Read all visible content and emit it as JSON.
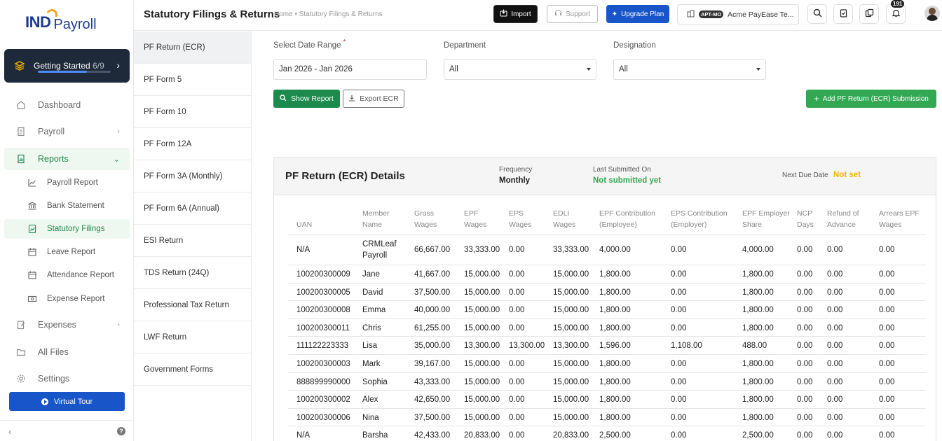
{
  "sidebar": {
    "logo": {
      "ind": "IND",
      "payroll": "Payroll"
    },
    "getting_started": {
      "label": "Getting Started",
      "count": "6/9",
      "progress": 0.67
    },
    "nav": [
      {
        "label": "Dashboard"
      },
      {
        "label": "Payroll"
      },
      {
        "label": "Reports"
      },
      {
        "label": "Expenses"
      },
      {
        "label": "All Files"
      },
      {
        "label": "Settings"
      }
    ],
    "reports_sub": [
      {
        "label": "Payroll Report"
      },
      {
        "label": "Bank Statement"
      },
      {
        "label": "Statutory Filings"
      },
      {
        "label": "Leave Report"
      },
      {
        "label": "Attendance Report"
      },
      {
        "label": "Expense Report"
      }
    ],
    "virtual_tour": "Virtual Tour"
  },
  "header": {
    "title": "Statutory Filings & Returns",
    "breadcrumb": "Home • Statutory Filings & Returns",
    "import": "Import",
    "support": "Support",
    "upgrade": "Upgrade Plan",
    "company_tag": "APT-MO",
    "company_name": "Acme PayEase Te...",
    "notification_count": "191"
  },
  "submenu": [
    "PF Return (ECR)",
    "PF Form 5",
    "PF Form 10",
    "PF Form 12A",
    "PF Form 3A (Monthly)",
    "PF Form 6A (Annual)",
    "ESI Return",
    "TDS Return (24Q)",
    "Professional Tax Return",
    "LWF Return",
    "Government Forms"
  ],
  "filters": {
    "date_label": "Select Date Range",
    "date_value": "Jan 2026 - Jan 2026",
    "dept_label": "Department",
    "dept_value": "All",
    "desig_label": "Designation",
    "desig_value": "All",
    "show_report": "Show Report",
    "export_ecr": "Export ECR",
    "add_submission": "Add PF Return (ECR) Submission"
  },
  "details": {
    "title": "PF Return (ECR) Details",
    "frequency_label": "Frequency",
    "frequency_value": "Monthly",
    "last_label": "Last Submitted On",
    "last_value": "Not submitted yet",
    "next_label": "Next Due Date",
    "next_value": "Not set"
  },
  "table": {
    "columns": [
      [
        "",
        "UAN"
      ],
      [
        "Member",
        "Name"
      ],
      [
        "Gross",
        "Wages"
      ],
      [
        "EPF",
        "Wages"
      ],
      [
        "EPS",
        "Wages"
      ],
      [
        "EDLI",
        "Wages"
      ],
      [
        "EPF Contribution",
        "(Employee)"
      ],
      [
        "EPS Contribution",
        "(Employer)"
      ],
      [
        "EPF Employer",
        "Share"
      ],
      [
        "NCP",
        "Days"
      ],
      [
        "Refund of",
        "Advance"
      ],
      [
        "Arrears EPF",
        "Wages"
      ]
    ],
    "rows": [
      [
        "N/A",
        "CRMLeaf Payroll",
        "66,667.00",
        "33,333.00",
        "0.00",
        "33,333.00",
        "4,000.00",
        "0.00",
        "4,000.00",
        "0.00",
        "0.00",
        "0.00"
      ],
      [
        "100200300009",
        "Jane",
        "41,667.00",
        "15,000.00",
        "0.00",
        "15,000.00",
        "1,800.00",
        "0.00",
        "1,800.00",
        "0.00",
        "0.00",
        "0.00"
      ],
      [
        "100200300005",
        "David",
        "37,500.00",
        "15,000.00",
        "0.00",
        "15,000.00",
        "1,800.00",
        "0.00",
        "1,800.00",
        "0.00",
        "0.00",
        "0.00"
      ],
      [
        "100200300008",
        "Emma",
        "40,000.00",
        "15,000.00",
        "0.00",
        "15,000.00",
        "1,800.00",
        "0.00",
        "1,800.00",
        "0.00",
        "0.00",
        "0.00"
      ],
      [
        "100200300011",
        "Chris",
        "61,255.00",
        "15,000.00",
        "0.00",
        "15,000.00",
        "1,800.00",
        "0.00",
        "1,800.00",
        "0.00",
        "0.00",
        "0.00"
      ],
      [
        "111122223333",
        "Lisa",
        "35,000.00",
        "13,300.00",
        "13,300.00",
        "13,300.00",
        "1,596.00",
        "1,108.00",
        "488.00",
        "0.00",
        "0.00",
        "0.00"
      ],
      [
        "100200300003",
        "Mark",
        "39,167.00",
        "15,000.00",
        "0.00",
        "15,000.00",
        "1,800.00",
        "0.00",
        "1,800.00",
        "0.00",
        "0.00",
        "0.00"
      ],
      [
        "888899990000",
        "Sophia",
        "43,333.00",
        "15,000.00",
        "0.00",
        "15,000.00",
        "1,800.00",
        "0.00",
        "1,800.00",
        "0.00",
        "0.00",
        "0.00"
      ],
      [
        "100200300002",
        "Alex",
        "42,650.00",
        "15,000.00",
        "0.00",
        "15,000.00",
        "1,800.00",
        "0.00",
        "1,800.00",
        "0.00",
        "0.00",
        "0.00"
      ],
      [
        "100200300006",
        "Nina",
        "37,500.00",
        "15,000.00",
        "0.00",
        "15,000.00",
        "1,800.00",
        "0.00",
        "1,800.00",
        "0.00",
        "0.00",
        "0.00"
      ],
      [
        "N/A",
        "Barsha",
        "42,433.00",
        "20,833.00",
        "0.00",
        "20,833.00",
        "2,500.00",
        "0.00",
        "2,500.00",
        "0.00",
        "0.00",
        "0.00"
      ]
    ]
  }
}
